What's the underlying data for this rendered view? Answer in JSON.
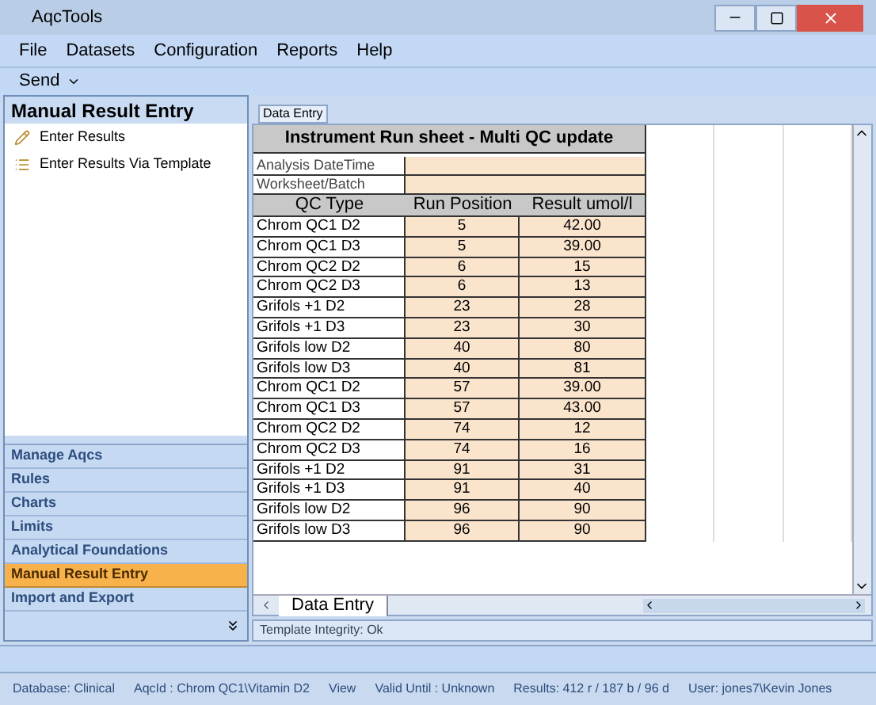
{
  "window": {
    "title": "AqcTools"
  },
  "menu": [
    "File",
    "Datasets",
    "Configuration",
    "Reports",
    "Help"
  ],
  "toolbar": {
    "send": "Send"
  },
  "sidebar": {
    "header": "Manual Result Entry",
    "items": [
      {
        "label": "Enter Results"
      },
      {
        "label": "Enter Results Via Template"
      }
    ],
    "nav": [
      {
        "label": "Manage Aqcs",
        "selected": false
      },
      {
        "label": "Rules",
        "selected": false
      },
      {
        "label": "Charts",
        "selected": false
      },
      {
        "label": "Limits",
        "selected": false
      },
      {
        "label": "Analytical Foundations",
        "selected": false
      },
      {
        "label": "Manual Result Entry",
        "selected": true
      },
      {
        "label": "Import and Export",
        "selected": false
      }
    ]
  },
  "doc_tab": "Data Entry",
  "sheet": {
    "title": "Instrument Run sheet - Multi QC update",
    "fields": [
      "Analysis DateTime",
      "Worksheet/Batch"
    ],
    "columns": [
      "QC Type",
      "Run Position",
      "Result umol/l"
    ],
    "rows": [
      [
        "Chrom QC1 D2",
        "5",
        "42.00"
      ],
      [
        "Chrom QC1 D3",
        "5",
        "39.00"
      ],
      [
        "Chrom QC2 D2",
        "6",
        "15"
      ],
      [
        "Chrom QC2 D3",
        "6",
        "13"
      ],
      [
        "Grifols +1 D2",
        "23",
        "28"
      ],
      [
        "Grifols +1 D3",
        "23",
        "30"
      ],
      [
        "Grifols low D2",
        "40",
        "80"
      ],
      [
        "Grifols low D3",
        "40",
        "81"
      ],
      [
        "Chrom QC1 D2",
        "57",
        "39.00"
      ],
      [
        "Chrom QC1 D3",
        "57",
        "43.00"
      ],
      [
        "Chrom QC2 D2",
        "74",
        "12"
      ],
      [
        "Chrom QC2 D3",
        "74",
        "16"
      ],
      [
        "Grifols +1 D2",
        "91",
        "31"
      ],
      [
        "Grifols +1 D3",
        "91",
        "40"
      ],
      [
        "Grifols low D2",
        "96",
        "90"
      ],
      [
        "Grifols low D3",
        "96",
        "90"
      ]
    ],
    "sheet_tab": "Data Entry"
  },
  "integrity": "Template Integrity: Ok",
  "status_bar": [
    "Database: Clinical",
    "AqcId : Chrom QC1\\Vitamin D2",
    "View",
    "Valid Until : Unknown",
    "Results: 412 r / 187 b / 96 d",
    "User: jones7\\Kevin Jones"
  ]
}
